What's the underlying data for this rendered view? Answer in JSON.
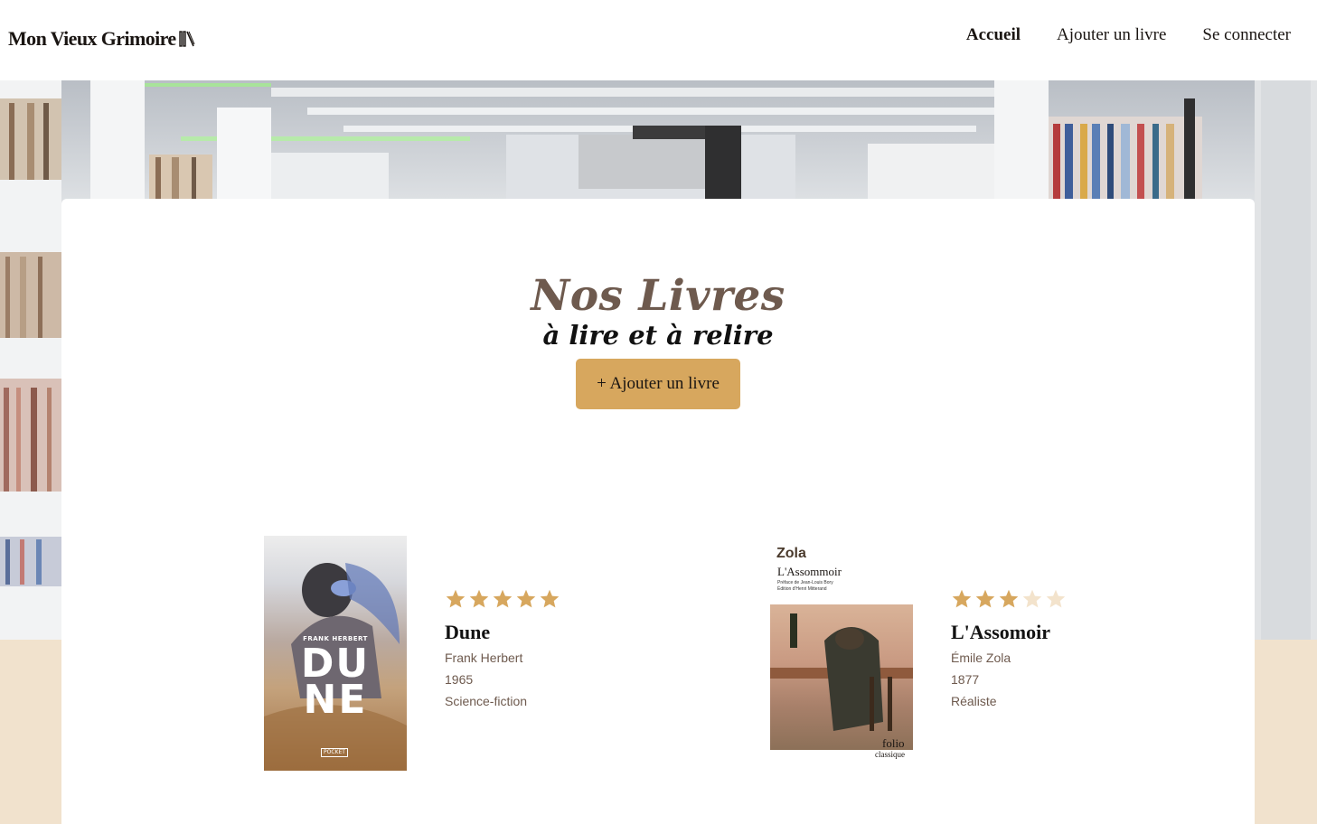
{
  "header": {
    "logo_text": "Mon Vieux Grimoire",
    "logo_icon": "books-icon",
    "nav": [
      {
        "label": "Accueil",
        "active": true
      },
      {
        "label": "Ajouter un livre",
        "active": false
      },
      {
        "label": "Se connecter",
        "active": false
      }
    ]
  },
  "main": {
    "title": "Nos Livres",
    "subtitle": "à lire et à relire",
    "add_button": "+ Ajouter un livre"
  },
  "books": [
    {
      "title": "Dune",
      "author": "Frank Herbert",
      "year": "1965",
      "genre": "Science-fiction",
      "rating": 5,
      "max_rating": 5,
      "cover_author": "FRANK HERBERT",
      "cover_title_top": "DU",
      "cover_title_bottom": "NE",
      "cover_publisher": "POCKET"
    },
    {
      "title": "L'Assomoir",
      "author": "Émile Zola",
      "year": "1877",
      "genre": "Réaliste",
      "rating": 3,
      "max_rating": 5,
      "cover_author": "Zola",
      "cover_title": "L'Assommoir",
      "cover_preface": "Préface de Jean-Louis Bory",
      "cover_edition": "Édition d'Henri Mitterand",
      "cover_publisher": "folio",
      "cover_collection": "classique"
    }
  ],
  "colors": {
    "accent": "#d7a75e",
    "star_filled": "#d7a75e",
    "star_empty": "#f3e3cc",
    "meta_text": "#6e5a4e",
    "footer_band": "#f1e2cd"
  }
}
